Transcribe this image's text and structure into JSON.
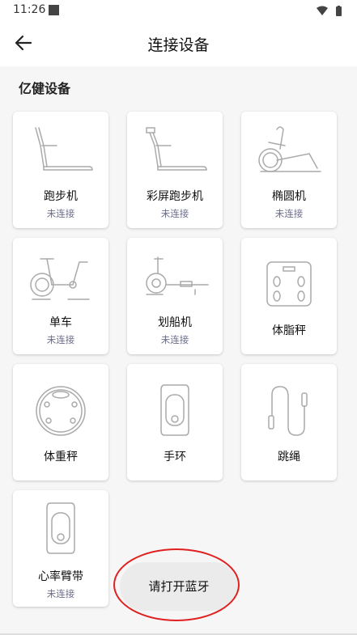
{
  "status_bar": {
    "time": "11:26"
  },
  "app_bar": {
    "title": "连接设备",
    "back_icon": "arrow-left-icon"
  },
  "section": {
    "title": "亿健设备"
  },
  "devices": [
    {
      "name": "跑步机",
      "status": "未连接",
      "icon": "treadmill-icon"
    },
    {
      "name": "彩屏跑步机",
      "status": "未连接",
      "icon": "color-screen-treadmill-icon"
    },
    {
      "name": "椭圆机",
      "status": "未连接",
      "icon": "elliptical-icon"
    },
    {
      "name": "单车",
      "status": "未连接",
      "icon": "bike-icon"
    },
    {
      "name": "划船机",
      "status": "未连接",
      "icon": "rowing-machine-icon"
    },
    {
      "name": "体脂秤",
      "status": "",
      "icon": "body-fat-scale-icon"
    },
    {
      "name": "体重秤",
      "status": "",
      "icon": "weight-scale-icon"
    },
    {
      "name": "手环",
      "status": "",
      "icon": "wristband-icon"
    },
    {
      "name": "跳绳",
      "status": "",
      "icon": "jump-rope-icon"
    },
    {
      "name": "心率臂带",
      "status": "未连接",
      "icon": "heart-rate-armband-icon"
    }
  ],
  "bluetooth_button": {
    "label": "请打开蓝牙"
  }
}
